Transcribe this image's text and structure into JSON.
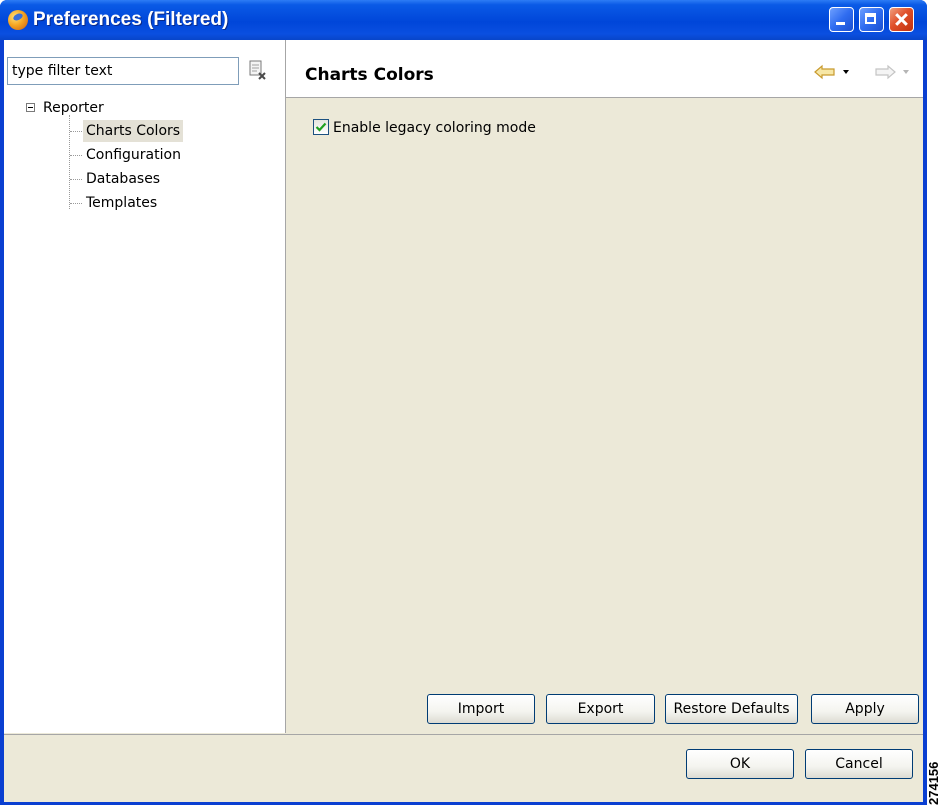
{
  "window": {
    "title": "Preferences (Filtered)"
  },
  "filter": {
    "placeholder": "type filter text",
    "value": "type filter text"
  },
  "tree": {
    "root": "Reporter",
    "children": [
      {
        "label": "Charts Colors",
        "selected": true
      },
      {
        "label": "Configuration",
        "selected": false
      },
      {
        "label": "Databases",
        "selected": false
      },
      {
        "label": "Templates",
        "selected": false
      }
    ]
  },
  "page": {
    "title": "Charts Colors",
    "legacy_checkbox": {
      "label": "Enable legacy coloring mode",
      "checked": true
    },
    "buttons": {
      "import": "Import",
      "export": "Export",
      "restore_defaults": "Restore Defaults",
      "apply": "Apply"
    }
  },
  "footer": {
    "ok": "OK",
    "cancel": "Cancel"
  },
  "figure_id": "274156",
  "colors": {
    "titlebar": "#0046d9",
    "dialog_bg": "#ece9d8",
    "back_arrow": "#e8b84a",
    "check_mark": "#21a121"
  },
  "icons": {
    "app": "preferences-app-icon",
    "clear_filter": "clear-filter-icon",
    "back": "back-arrow-icon",
    "forward": "forward-arrow-icon"
  }
}
